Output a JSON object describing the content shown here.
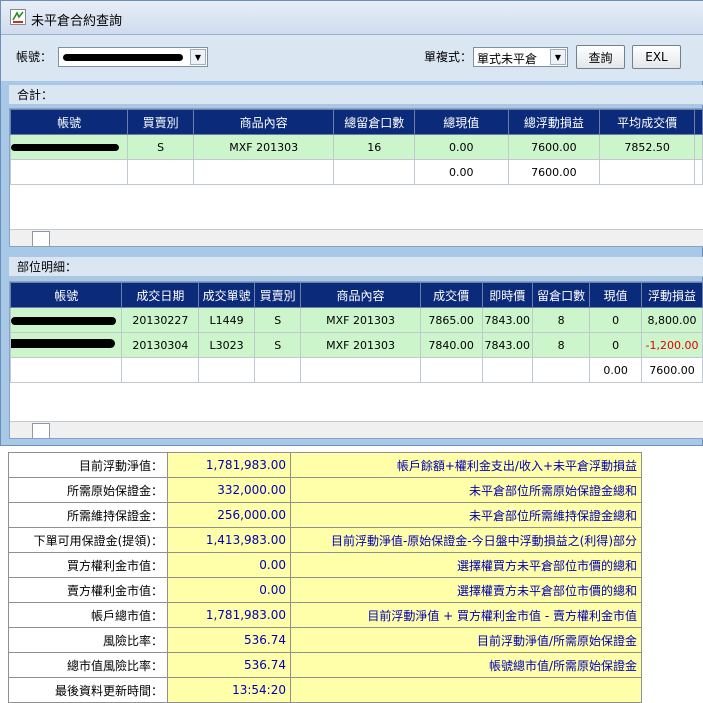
{
  "window": {
    "title": "未平倉合約查詢"
  },
  "toolbar": {
    "account_label": "帳號：",
    "mode_label": "單複式：",
    "mode_value": "單式未平倉",
    "query_button": "查詢",
    "exl_button": "EXL"
  },
  "summary": {
    "section_label": "合計：",
    "columns": [
      "帳號",
      "買賣別",
      "商品內容",
      "總留倉口數",
      "總現值",
      "總浮動損益",
      "平均成交價"
    ],
    "rows": [
      [
        "",
        "S",
        "MXF 201303",
        "16",
        "0.00",
        "7600.00",
        "7852.50"
      ],
      [
        "",
        "",
        "",
        "",
        "0.00",
        "7600.00",
        ""
      ]
    ]
  },
  "detail": {
    "section_label": "部位明細：",
    "columns": [
      "帳號",
      "成交日期",
      "成交單號",
      "買賣別",
      "商品內容",
      "成交價",
      "即時價",
      "留倉口數",
      "現值",
      "浮動損益"
    ],
    "rows": [
      [
        "",
        "20130227",
        "L1449",
        "S",
        "MXF 201303",
        "7865.00",
        "7843.00",
        "8",
        "0",
        "8,800.00"
      ],
      [
        "",
        "20130304",
        "L3023",
        "S",
        "MXF 201303",
        "7840.00",
        "7843.00",
        "8",
        "0",
        "-1,200.00"
      ],
      [
        "",
        "",
        "",
        "",
        "",
        "",
        "",
        "",
        "0.00",
        "7600.00"
      ]
    ]
  },
  "info": [
    {
      "label": "目前浮動淨值：",
      "value": "1,781,983.00",
      "desc": "帳戶餘額+權利金支出/收入+未平倉浮動損益"
    },
    {
      "label": "所需原始保證金：",
      "value": "332,000.00",
      "desc": "未平倉部位所需原始保證金總和"
    },
    {
      "label": "所需維持保證金：",
      "value": "256,000.00",
      "desc": "未平倉部位所需維持保證金總和"
    },
    {
      "label": "下單可用保證金(提領)：",
      "value": "1,413,983.00",
      "desc": "目前浮動淨值-原始保證金-今日盤中浮動損益之(利得)部分"
    },
    {
      "label": "買方權利金市值：",
      "value": "0.00",
      "desc": "選擇權買方未平倉部位市價的總和"
    },
    {
      "label": "賣方權利金市值：",
      "value": "0.00",
      "desc": "選擇權賣方未平倉部位市價的總和"
    },
    {
      "label": "帳戶總市值：",
      "value": "1,781,983.00",
      "desc": "目前浮動淨值 + 買方權利金市值 - 賣方權利金市值"
    },
    {
      "label": "風險比率：",
      "value": "536.74",
      "desc": "目前浮動淨值/所需原始保證金"
    },
    {
      "label": "總市值風險比率：",
      "value": "536.74",
      "desc": "帳號總市值/所需原始保證金"
    },
    {
      "label": "最後資料更新時間：",
      "value": "13:54:20",
      "desc": ""
    }
  ]
}
